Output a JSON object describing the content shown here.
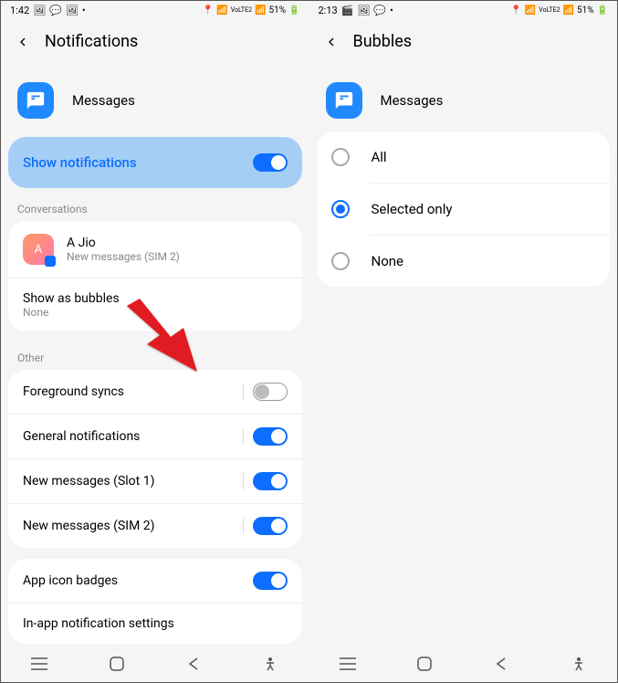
{
  "screen1": {
    "status": {
      "time": "1:42",
      "battery": "51%",
      "network": "VoLTE2"
    },
    "title": "Notifications",
    "app_name": "Messages",
    "show_notifications_label": "Show notifications",
    "sections": {
      "conversations": "Conversations",
      "other": "Other"
    },
    "conversation": {
      "name": "A Jio",
      "sub": "New messages (SIM 2)",
      "avatar_initial": "A"
    },
    "show_bubbles": {
      "title": "Show as bubbles",
      "value": "None"
    },
    "other_items": [
      {
        "label": "Foreground syncs",
        "on": false
      },
      {
        "label": "General notifications",
        "on": true
      },
      {
        "label": "New messages (Slot 1)",
        "on": true
      },
      {
        "label": "New messages (SIM 2)",
        "on": true
      }
    ],
    "badges": {
      "label": "App icon badges",
      "on": true
    },
    "inapp": {
      "label": "In-app notification settings"
    }
  },
  "screen2": {
    "status": {
      "time": "2:13",
      "battery": "51%",
      "network": "VoLTE2"
    },
    "title": "Bubbles",
    "app_name": "Messages",
    "options": [
      {
        "label": "All",
        "selected": false
      },
      {
        "label": "Selected only",
        "selected": true
      },
      {
        "label": "None",
        "selected": false
      }
    ]
  }
}
